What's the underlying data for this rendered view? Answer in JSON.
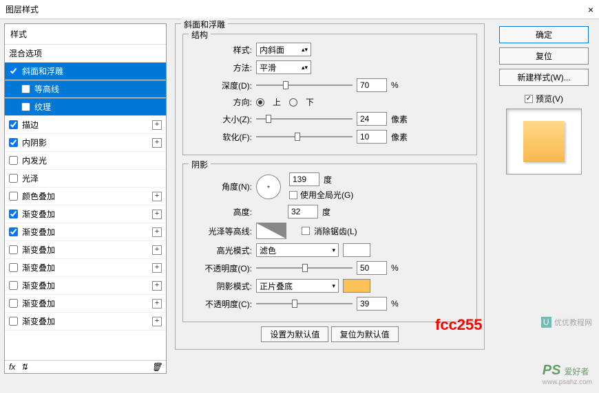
{
  "window": {
    "title": "图层样式",
    "close": "×"
  },
  "sidebar": {
    "header": "样式",
    "items": [
      {
        "label": "混合选项",
        "checked": false,
        "plus": false,
        "indent": false,
        "nocb": true
      },
      {
        "label": "斜面和浮雕",
        "checked": true,
        "plus": false,
        "selected": true
      },
      {
        "label": "等高线",
        "checked": false,
        "indent": true,
        "selected": true
      },
      {
        "label": "纹理",
        "checked": false,
        "indent": true,
        "selected": true
      },
      {
        "label": "描边",
        "checked": true,
        "plus": true
      },
      {
        "label": "内阴影",
        "checked": true,
        "plus": true
      },
      {
        "label": "内发光",
        "checked": false
      },
      {
        "label": "光泽",
        "checked": false
      },
      {
        "label": "颜色叠加",
        "checked": false,
        "plus": true
      },
      {
        "label": "渐变叠加",
        "checked": true,
        "plus": true
      },
      {
        "label": "渐变叠加",
        "checked": true,
        "plus": true
      },
      {
        "label": "渐变叠加",
        "checked": false,
        "plus": true
      },
      {
        "label": "渐变叠加",
        "checked": false,
        "plus": true
      },
      {
        "label": "渐变叠加",
        "checked": false,
        "plus": true
      },
      {
        "label": "渐变叠加",
        "checked": false,
        "plus": true
      },
      {
        "label": "渐变叠加",
        "checked": false,
        "plus": true
      }
    ],
    "footer": {
      "fx": "fx"
    }
  },
  "main": {
    "title": "斜面和浮雕",
    "structure": {
      "legend": "结构",
      "style_label": "样式:",
      "style_value": "内斜面",
      "method_label": "方法:",
      "method_value": "平滑",
      "depth_label": "深度(D):",
      "depth_value": "70",
      "depth_unit": "%",
      "direction_label": "方向:",
      "up": "上",
      "down": "下",
      "size_label": "大小(Z):",
      "size_value": "24",
      "size_unit": "像素",
      "soften_label": "软化(F):",
      "soften_value": "10",
      "soften_unit": "像素"
    },
    "shading": {
      "legend": "阴影",
      "angle_label": "角度(N):",
      "angle_value": "139",
      "angle_unit": "度",
      "global_label": "使用全局光(G)",
      "altitude_label": "高度:",
      "altitude_value": "32",
      "altitude_unit": "度",
      "gloss_label": "光泽等高线:",
      "antialias_label": "消除锯齿(L)",
      "highlight_mode_label": "高光模式:",
      "highlight_mode_value": "滤色",
      "opacity1_label": "不透明度(O):",
      "opacity1_value": "50",
      "opacity1_unit": "%",
      "shadow_mode_label": "阴影模式:",
      "shadow_mode_value": "正片叠底",
      "opacity2_label": "不透明度(C):",
      "opacity2_value": "39",
      "opacity2_unit": "%"
    },
    "bottom": {
      "default": "设置为默认值",
      "reset": "复位为默认值"
    }
  },
  "right": {
    "ok": "确定",
    "cancel": "复位",
    "new_style": "新建样式(W)...",
    "preview": "预览(V)"
  },
  "annotation": "fcc255",
  "watermark1": "优优教程网",
  "watermark2a": "PS",
  "watermark2b": "爱好者",
  "watermark2c": "www.psahz.com"
}
